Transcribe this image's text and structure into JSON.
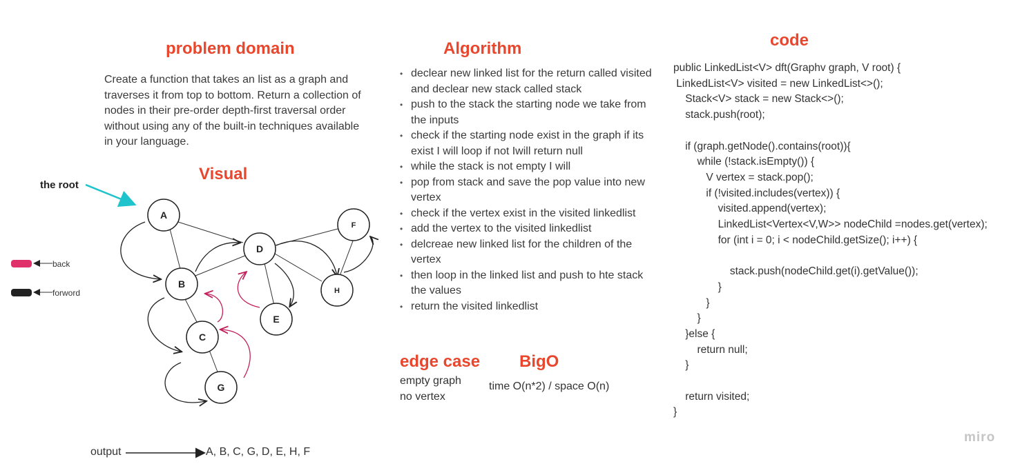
{
  "problem_domain": {
    "title": "problem domain",
    "description": "Create a function that takes an list as a graph and traverses it from top to bottom. Return a collection of nodes in their pre-order depth-first traversal order without using any of the built-in techniques available in your language."
  },
  "visual": {
    "title": "Visual",
    "root_label": "the root",
    "legend": {
      "back": "back",
      "forward": "forword",
      "back_color": "#e0306c",
      "forward_color": "#222222"
    },
    "nodes": [
      "A",
      "B",
      "C",
      "D",
      "E",
      "F",
      "G",
      "H"
    ],
    "output_label": "output",
    "output_value": "A, B, C, G, D, E, H, F"
  },
  "algorithm": {
    "title": "Algorithm",
    "steps": [
      "declear new linked list for the return called visited and declear new stack called stack",
      "push to the stack the starting node we take from the inputs",
      "check if the starting node exist in the graph if its exist I will loop if not Iwill return null",
      "while the stack is not empty I will",
      "pop from stack and save the pop value into new vertex",
      "check if the vertex exist in the visited linkedlist",
      "add the vertex to the visited linkedlist",
      "delcreae new linked list for the children of the vertex",
      "then loop in the linked list and push to hte stack the values",
      "return the visited linkedlist"
    ]
  },
  "edge_case": {
    "title": "edge case",
    "items": [
      "empty graph",
      "no vertex"
    ]
  },
  "bigo": {
    "title": "BigO",
    "value": "time O(n*2) / space O(n)"
  },
  "code": {
    "title": "code",
    "lines": [
      "public LinkedList<V> dft(Graphv graph, V root) {",
      " LinkedList<V> visited = new LinkedList<>();",
      "    Stack<V> stack = new Stack<>();",
      "    stack.push(root);",
      "",
      "    if (graph.getNode().contains(root)){",
      "        while (!stack.isEmpty()) {",
      "           V vertex = stack.pop();",
      "           if (!visited.includes(vertex)) {",
      "               visited.append(vertex);",
      "               LinkedList<Vertex<V,W>> nodeChild =nodes.get(vertex);",
      "               for (int i = 0; i < nodeChild.getSize(); i++) {",
      "",
      "                   stack.push(nodeChild.get(i).getValue());",
      "               }",
      "           }",
      "        }",
      "    }else {",
      "        return null;",
      "    }",
      "",
      "    return visited;",
      "}"
    ]
  },
  "watermark": "miro"
}
